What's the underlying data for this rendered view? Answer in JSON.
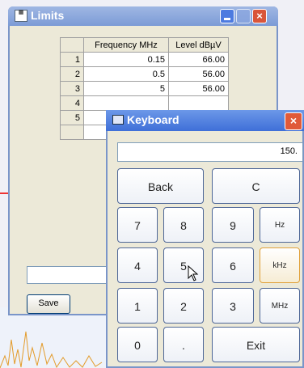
{
  "limits": {
    "title": "Limits",
    "columns": [
      "Frequency MHz",
      "Level dBµV"
    ],
    "rows": [
      {
        "num": "1",
        "freq": "0.15",
        "level": "66.00"
      },
      {
        "num": "2",
        "freq": "0.5",
        "level": "56.00"
      },
      {
        "num": "3",
        "freq": "5",
        "level": "56.00"
      },
      {
        "num": "4",
        "freq": "",
        "level": ""
      },
      {
        "num": "5",
        "freq": "",
        "level": ""
      }
    ],
    "save_label": "Save"
  },
  "keyboard": {
    "title": "Keyboard",
    "display_value": "150.",
    "keys": {
      "back": "Back",
      "clear": "C",
      "k7": "7",
      "k8": "8",
      "k9": "9",
      "hz": "Hz",
      "k4": "4",
      "k5": "5",
      "k6": "6",
      "khz": "kHz",
      "k1": "1",
      "k2": "2",
      "k3": "3",
      "mhz": "MHz",
      "k0": "0",
      "dot": ".",
      "exit": "Exit"
    }
  },
  "colors": {
    "titlebar_active": "#3f6fd8",
    "close_button": "#e05a3a",
    "key_border": "#4e6797",
    "key_hover_border": "#e0a13a"
  }
}
